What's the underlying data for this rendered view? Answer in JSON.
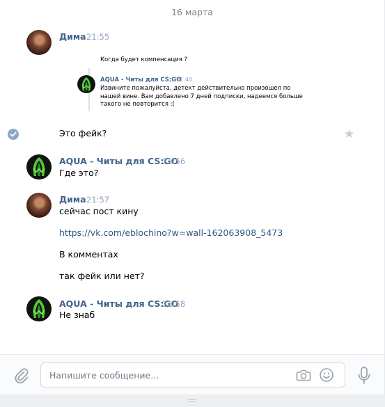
{
  "date_separator": "16 марта",
  "colors": {
    "author": "#42648b",
    "time": "#93a3bc",
    "link": "#2a5885",
    "icon": "#99a2ad",
    "panel_bg": "#ffffff",
    "page_bg": "#edeef0"
  },
  "messages": [
    {
      "author": "Дима",
      "time": "21:55",
      "avatar_icon": "user-photo-avatar",
      "forward": {
        "text": "Когда будет компенсация ?",
        "author": "AQUA - Читы для CS:GO",
        "time": "21:40",
        "body": "Извините пожалуйста, детект действительно произошел по нашей вине. Вам добавлено 7 дней подписки, надеемся больше такого не повторится :("
      },
      "text": "Это фейк?"
    },
    {
      "author": "AQUA - Читы для CS:GO",
      "time": "21:56",
      "avatar_icon": "aqua-logo-avatar",
      "lines": [
        "Где это?"
      ]
    },
    {
      "author": "Дима",
      "time": "21:57",
      "avatar_icon": "user-photo-avatar",
      "lines": [
        "сейчас пост кину",
        "https://vk.com/eblochino?w=wall-162063908_5473",
        "В комментах",
        "так фейк или нет?"
      ]
    },
    {
      "author": "AQUA - Читы для CS:GO",
      "time": "21:58",
      "avatar_icon": "aqua-logo-avatar",
      "lines": [
        "Не знаб"
      ]
    }
  ],
  "composer": {
    "placeholder": "Напишите сообщение...",
    "value": "",
    "icons": [
      "paperclip-icon",
      "camera-icon",
      "smile-icon",
      "microphone-icon"
    ]
  }
}
